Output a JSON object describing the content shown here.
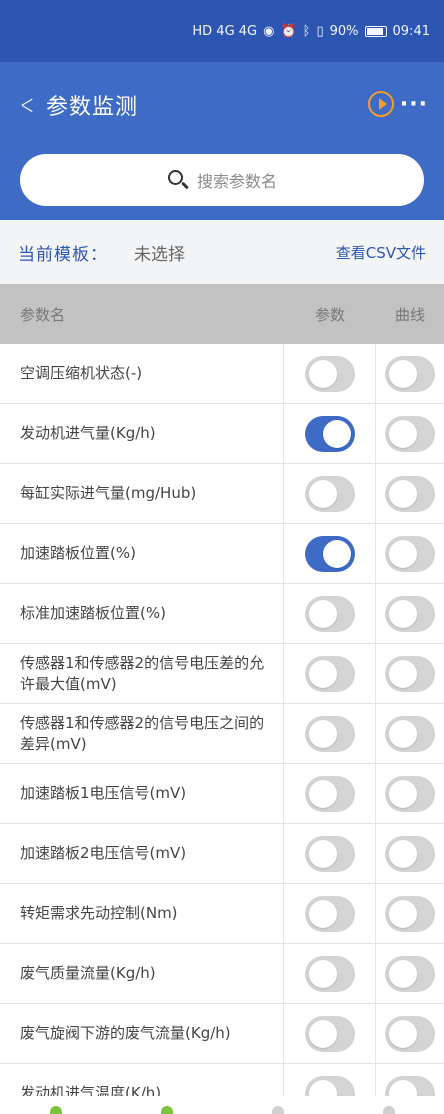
{
  "status": {
    "network": "HD 4G 4G",
    "battery": "90%",
    "time": "09:41"
  },
  "appbar": {
    "title": "参数监测"
  },
  "search": {
    "placeholder": "搜索参数名"
  },
  "template": {
    "label": "当前模板：",
    "value": "未选择",
    "csv_link": "查看CSV文件"
  },
  "table": {
    "headers": {
      "name": "参数名",
      "param": "参数",
      "curve": "曲线"
    },
    "rows": [
      {
        "name": "空调压缩机状态(-)",
        "param_on": false,
        "curve_on": false
      },
      {
        "name": "发动机进气量(Kg/h)",
        "param_on": true,
        "curve_on": false
      },
      {
        "name": "每缸实际进气量(mg/Hub)",
        "param_on": false,
        "curve_on": false
      },
      {
        "name": "加速踏板位置(%)",
        "param_on": true,
        "curve_on": false
      },
      {
        "name": "标准加速踏板位置(%)",
        "param_on": false,
        "curve_on": false
      },
      {
        "name": "传感器1和传感器2的信号电压差的允许最大值(mV)",
        "param_on": false,
        "curve_on": false
      },
      {
        "name": "传感器1和传感器2的信号电压之间的差异(mV)",
        "param_on": false,
        "curve_on": false
      },
      {
        "name": "加速踏板1电压信号(mV)",
        "param_on": false,
        "curve_on": false
      },
      {
        "name": "加速踏板2电压信号(mV)",
        "param_on": false,
        "curve_on": false
      },
      {
        "name": "转矩需求先动控制(Nm)",
        "param_on": false,
        "curve_on": false
      },
      {
        "name": "废气质量流量(Kg/h)",
        "param_on": false,
        "curve_on": false
      },
      {
        "name": "废气旋阀下游的废气流量(Kg/h)",
        "param_on": false,
        "curve_on": false
      },
      {
        "name": "发动机进气温度(K/h)",
        "param_on": false,
        "curve_on": false
      }
    ]
  },
  "colors": {
    "primary": "#3d6bc6",
    "accent": "#f39c2a",
    "bottom_active": "#7cc53a"
  }
}
